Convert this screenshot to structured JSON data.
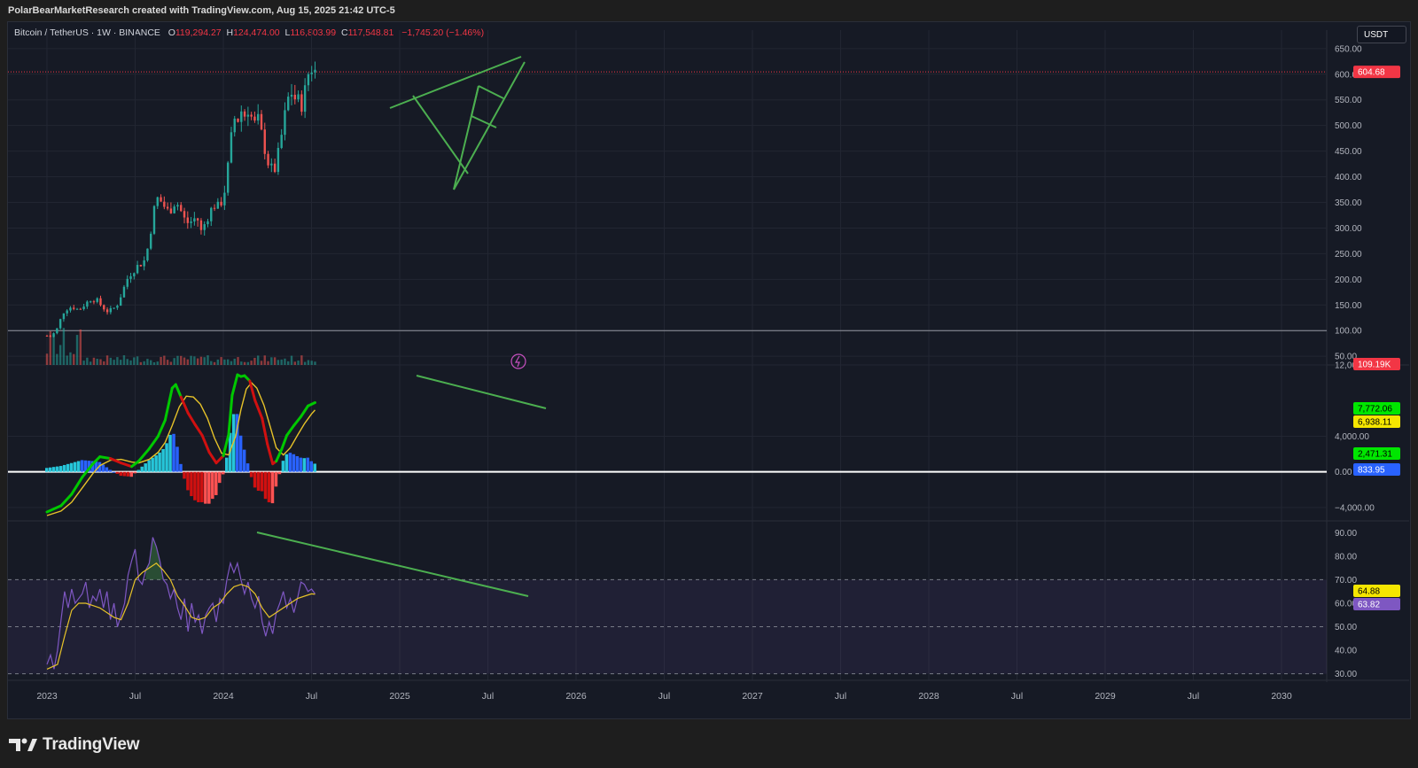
{
  "header": {
    "attribution": "PolarBearMarketResearch created with TradingView.com, Aug 15, 2025 21:42 UTC-5"
  },
  "symbol": {
    "name": "Bitcoin / TetherUS · 1W · BINANCE",
    "open_label": "O",
    "open": "119,294.27",
    "high_label": "H",
    "high": "124,474.00",
    "low_label": "L",
    "low": "116,803.99",
    "close_label": "C",
    "close": "117,548.81",
    "change": "−1,745.20 (−1.46%)"
  },
  "currency_button": "USDT",
  "branding": {
    "logo_text": "TradingView"
  },
  "colors": {
    "background": "#161a25",
    "up": "#26a69a",
    "down": "#ef5350",
    "trendline": "#4caf50",
    "macd_up": "#00c800",
    "macd_down": "#d01010",
    "signal": "#e6c229",
    "rsi": "#7e57c2",
    "rsi_ma": "#e6c229",
    "label_green": "#00e600",
    "label_yellow": "#f5e600",
    "label_blue": "#2962ff",
    "label_red": "#f23645",
    "label_purple": "#7e57c2"
  },
  "chart_data": [
    {
      "pane": "price",
      "type": "candlestick",
      "title": "Bitcoin / TetherUS · 1W · BINANCE",
      "y_tick_labels": [
        "650.00",
        "600.00",
        "550.00",
        "500.00",
        "450.00",
        "400.00",
        "350.00",
        "300.00",
        "250.00",
        "200.00",
        "150.00",
        "100.00",
        "50.00"
      ],
      "y_ticks": [
        650,
        600,
        550,
        500,
        450,
        400,
        350,
        300,
        250,
        200,
        150,
        100,
        50
      ],
      "ylim": [
        33,
        686
      ],
      "x_ticks": [
        "2023",
        "Jul",
        "2024",
        "Jul",
        "2025",
        "Jul",
        "2026",
        "Jul",
        "2027",
        "Jul",
        "2028",
        "Jul",
        "2029",
        "Jul",
        "2030"
      ],
      "close_path": [
        [
          0,
          90
        ],
        [
          0.02,
          88
        ],
        [
          0.04,
          95
        ],
        [
          0.06,
          105
        ],
        [
          0.09,
          135
        ],
        [
          0.12,
          145
        ],
        [
          0.15,
          146
        ],
        [
          0.18,
          140
        ],
        [
          0.21,
          150
        ],
        [
          0.25,
          162
        ],
        [
          0.28,
          160
        ],
        [
          0.31,
          148
        ],
        [
          0.34,
          138
        ],
        [
          0.37,
          140
        ],
        [
          0.4,
          152
        ],
        [
          0.43,
          178
        ],
        [
          0.46,
          205
        ],
        [
          0.49,
          218
        ],
        [
          0.52,
          228
        ],
        [
          0.55,
          235
        ],
        [
          0.57,
          260
        ],
        [
          0.59,
          300
        ],
        [
          0.61,
          340
        ],
        [
          0.63,
          360
        ],
        [
          0.66,
          345
        ],
        [
          0.69,
          330
        ],
        [
          0.72,
          350
        ],
        [
          0.75,
          345
        ],
        [
          0.77,
          320
        ],
        [
          0.8,
          310
        ],
        [
          0.83,
          315
        ],
        [
          0.85,
          325
        ],
        [
          0.87,
          290
        ],
        [
          0.89,
          305
        ],
        [
          0.92,
          330
        ],
        [
          0.95,
          345
        ],
        [
          0.97,
          340
        ],
        [
          1.0,
          360
        ],
        [
          1.02,
          400
        ],
        [
          1.04,
          460
        ],
        [
          1.06,
          515
        ],
        [
          1.08,
          510
        ],
        [
          1.1,
          530
        ],
        [
          1.12,
          520
        ],
        [
          1.14,
          535
        ],
        [
          1.16,
          515
        ],
        [
          1.18,
          500
        ],
        [
          1.2,
          510
        ],
        [
          1.22,
          475
        ],
        [
          1.24,
          450
        ],
        [
          1.26,
          420
        ],
        [
          1.28,
          410
        ],
        [
          1.3,
          420
        ],
        [
          1.32,
          460
        ],
        [
          1.34,
          500
        ],
        [
          1.36,
          540
        ],
        [
          1.38,
          570
        ],
        [
          1.4,
          555
        ],
        [
          1.42,
          548
        ],
        [
          1.44,
          540
        ],
        [
          1.46,
          560
        ],
        [
          1.48,
          600
        ],
        [
          1.5,
          615
        ],
        [
          1.52,
          605
        ]
      ],
      "volume_label": "109.19K",
      "last_price_label": "604.68",
      "trendlines": "green rising wedge and channel lines"
    },
    {
      "pane": "macd",
      "type": "line",
      "y_tick_labels": [
        "12,000.00",
        "4,000.00",
        "0.00",
        "−4,000.00"
      ],
      "y_ticks": [
        12000,
        4000,
        0,
        -4000
      ],
      "ylim": [
        -5500,
        12000
      ],
      "macd_path": [
        [
          0,
          -4500
        ],
        [
          0.08,
          -3800
        ],
        [
          0.14,
          -2500
        ],
        [
          0.2,
          -600
        ],
        [
          0.26,
          900
        ],
        [
          0.3,
          1700
        ],
        [
          0.36,
          1500
        ],
        [
          0.42,
          1000
        ],
        [
          0.48,
          600
        ],
        [
          0.52,
          1200
        ],
        [
          0.58,
          2600
        ],
        [
          0.63,
          4000
        ],
        [
          0.67,
          5800
        ],
        [
          0.71,
          9400
        ],
        [
          0.73,
          9800
        ],
        [
          0.76,
          8400
        ],
        [
          0.8,
          6600
        ],
        [
          0.84,
          5300
        ],
        [
          0.88,
          4100
        ],
        [
          0.92,
          2200
        ],
        [
          0.96,
          1000
        ],
        [
          1.0,
          1800
        ],
        [
          1.03,
          4200
        ],
        [
          1.05,
          8600
        ],
        [
          1.08,
          10900
        ],
        [
          1.1,
          10700
        ],
        [
          1.12,
          10800
        ],
        [
          1.15,
          10200
        ],
        [
          1.18,
          8000
        ],
        [
          1.22,
          6000
        ],
        [
          1.25,
          3100
        ],
        [
          1.28,
          900
        ],
        [
          1.3,
          1200
        ],
        [
          1.33,
          2500
        ],
        [
          1.36,
          4100
        ],
        [
          1.4,
          5200
        ],
        [
          1.44,
          6200
        ],
        [
          1.48,
          7400
        ],
        [
          1.52,
          7772
        ]
      ],
      "signal_path": [
        [
          0,
          -4900
        ],
        [
          0.08,
          -4400
        ],
        [
          0.14,
          -3400
        ],
        [
          0.2,
          -1800
        ],
        [
          0.26,
          -200
        ],
        [
          0.3,
          700
        ],
        [
          0.36,
          1300
        ],
        [
          0.42,
          1400
        ],
        [
          0.48,
          1100
        ],
        [
          0.52,
          1000
        ],
        [
          0.58,
          1400
        ],
        [
          0.63,
          2200
        ],
        [
          0.67,
          3300
        ],
        [
          0.71,
          5200
        ],
        [
          0.75,
          7300
        ],
        [
          0.79,
          8500
        ],
        [
          0.83,
          8400
        ],
        [
          0.87,
          7600
        ],
        [
          0.91,
          6000
        ],
        [
          0.95,
          3800
        ],
        [
          0.99,
          2100
        ],
        [
          1.03,
          1900
        ],
        [
          1.07,
          4000
        ],
        [
          1.1,
          7000
        ],
        [
          1.13,
          9300
        ],
        [
          1.16,
          10000
        ],
        [
          1.19,
          9400
        ],
        [
          1.23,
          7500
        ],
        [
          1.27,
          4800
        ],
        [
          1.3,
          2700
        ],
        [
          1.34,
          1900
        ],
        [
          1.38,
          2700
        ],
        [
          1.42,
          4100
        ],
        [
          1.46,
          5400
        ],
        [
          1.5,
          6500
        ],
        [
          1.52,
          6938
        ]
      ],
      "labels": [
        "7,772.06",
        "6,938.11",
        "2,471.31",
        "833.95"
      ]
    },
    {
      "pane": "rsi",
      "type": "line",
      "y_tick_labels": [
        "90.00",
        "80.00",
        "70.00",
        "60.00",
        "50.00",
        "40.00",
        "30.00"
      ],
      "y_ticks": [
        90,
        80,
        70,
        60,
        50,
        40,
        30
      ],
      "ylim": [
        28,
        95
      ],
      "band": [
        30,
        70
      ],
      "midline": 50,
      "rsi_path": [
        [
          0,
          34
        ],
        [
          0.02,
          38
        ],
        [
          0.04,
          32
        ],
        [
          0.06,
          40
        ],
        [
          0.08,
          53
        ],
        [
          0.1,
          65
        ],
        [
          0.12,
          58
        ],
        [
          0.14,
          66
        ],
        [
          0.16,
          60
        ],
        [
          0.18,
          62
        ],
        [
          0.2,
          64
        ],
        [
          0.22,
          69
        ],
        [
          0.24,
          58
        ],
        [
          0.26,
          63
        ],
        [
          0.28,
          61
        ],
        [
          0.3,
          66
        ],
        [
          0.32,
          58
        ],
        [
          0.34,
          65
        ],
        [
          0.36,
          53
        ],
        [
          0.38,
          60
        ],
        [
          0.4,
          50
        ],
        [
          0.42,
          55
        ],
        [
          0.44,
          60
        ],
        [
          0.46,
          72
        ],
        [
          0.48,
          78
        ],
        [
          0.5,
          83
        ],
        [
          0.52,
          70
        ],
        [
          0.54,
          68
        ],
        [
          0.56,
          74
        ],
        [
          0.58,
          77
        ],
        [
          0.6,
          88
        ],
        [
          0.62,
          84
        ],
        [
          0.64,
          78
        ],
        [
          0.66,
          70
        ],
        [
          0.68,
          68
        ],
        [
          0.7,
          62
        ],
        [
          0.72,
          66
        ],
        [
          0.74,
          58
        ],
        [
          0.76,
          53
        ],
        [
          0.78,
          62
        ],
        [
          0.8,
          48
        ],
        [
          0.82,
          60
        ],
        [
          0.84,
          52
        ],
        [
          0.86,
          55
        ],
        [
          0.88,
          47
        ],
        [
          0.9,
          55
        ],
        [
          0.92,
          58
        ],
        [
          0.94,
          60
        ],
        [
          0.96,
          52
        ],
        [
          0.98,
          62
        ],
        [
          1.0,
          60
        ],
        [
          1.02,
          70
        ],
        [
          1.04,
          77
        ],
        [
          1.06,
          73
        ],
        [
          1.08,
          77
        ],
        [
          1.1,
          70
        ],
        [
          1.12,
          64
        ],
        [
          1.14,
          69
        ],
        [
          1.16,
          62
        ],
        [
          1.18,
          58
        ],
        [
          1.2,
          63
        ],
        [
          1.22,
          52
        ],
        [
          1.24,
          46
        ],
        [
          1.26,
          52
        ],
        [
          1.28,
          47
        ],
        [
          1.3,
          56
        ],
        [
          1.32,
          60
        ],
        [
          1.34,
          65
        ],
        [
          1.36,
          58
        ],
        [
          1.38,
          62
        ],
        [
          1.4,
          56
        ],
        [
          1.42,
          62
        ],
        [
          1.44,
          69
        ],
        [
          1.46,
          68
        ],
        [
          1.48,
          65
        ],
        [
          1.5,
          66
        ],
        [
          1.52,
          64
        ]
      ],
      "rsi_ma_path": [
        [
          0,
          32
        ],
        [
          0.06,
          34
        ],
        [
          0.1,
          46
        ],
        [
          0.14,
          57
        ],
        [
          0.18,
          60
        ],
        [
          0.22,
          60
        ],
        [
          0.26,
          59
        ],
        [
          0.3,
          58
        ],
        [
          0.34,
          56
        ],
        [
          0.38,
          54
        ],
        [
          0.42,
          53
        ],
        [
          0.46,
          60
        ],
        [
          0.5,
          70
        ],
        [
          0.54,
          73
        ],
        [
          0.58,
          75
        ],
        [
          0.62,
          77
        ],
        [
          0.66,
          74
        ],
        [
          0.7,
          70
        ],
        [
          0.74,
          63
        ],
        [
          0.78,
          59
        ],
        [
          0.82,
          54
        ],
        [
          0.86,
          53
        ],
        [
          0.9,
          54
        ],
        [
          0.94,
          58
        ],
        [
          0.98,
          60
        ],
        [
          1.02,
          64
        ],
        [
          1.06,
          67
        ],
        [
          1.1,
          68
        ],
        [
          1.14,
          67
        ],
        [
          1.18,
          64
        ],
        [
          1.22,
          58
        ],
        [
          1.26,
          54
        ],
        [
          1.3,
          56
        ],
        [
          1.34,
          58
        ],
        [
          1.38,
          60
        ],
        [
          1.42,
          62
        ],
        [
          1.46,
          63
        ],
        [
          1.5,
          64
        ],
        [
          1.52,
          63.8
        ]
      ],
      "labels": [
        "64.88",
        "63.82"
      ]
    }
  ]
}
